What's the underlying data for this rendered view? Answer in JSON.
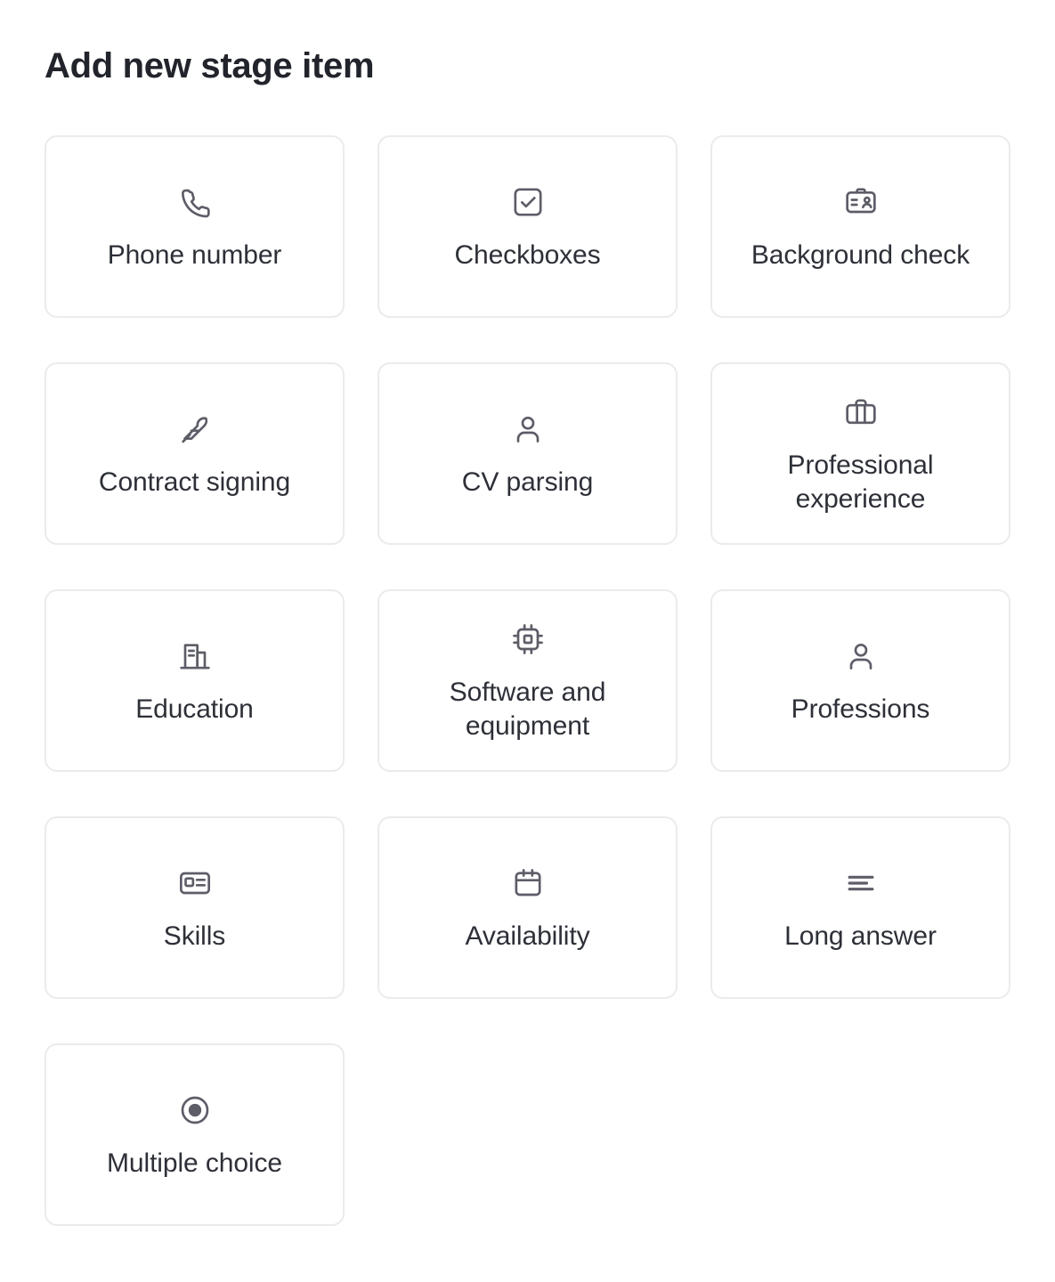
{
  "page": {
    "title": "Add new stage item"
  },
  "cards": [
    {
      "label": "Phone number",
      "icon": "phone-icon"
    },
    {
      "label": "Checkboxes",
      "icon": "checkbox-icon"
    },
    {
      "label": "Background check",
      "icon": "id-badge-icon"
    },
    {
      "label": "Contract signing",
      "icon": "feather-pen-icon"
    },
    {
      "label": "CV parsing",
      "icon": "person-icon"
    },
    {
      "label": "Professional experience",
      "icon": "briefcase-icon"
    },
    {
      "label": "Education",
      "icon": "building-icon"
    },
    {
      "label": "Software and equipment",
      "icon": "cpu-chip-icon"
    },
    {
      "label": "Professions",
      "icon": "person-icon"
    },
    {
      "label": "Skills",
      "icon": "id-card-icon"
    },
    {
      "label": "Availability",
      "icon": "calendar-icon"
    },
    {
      "label": "Long answer",
      "icon": "text-lines-icon"
    },
    {
      "label": "Multiple choice",
      "icon": "radio-selected-icon"
    }
  ],
  "colors": {
    "background": "#ffffff",
    "card_border": "#ebebeb",
    "title_text": "#22242b",
    "label_text": "#2e3038",
    "icon_stroke": "#5d5d68"
  }
}
